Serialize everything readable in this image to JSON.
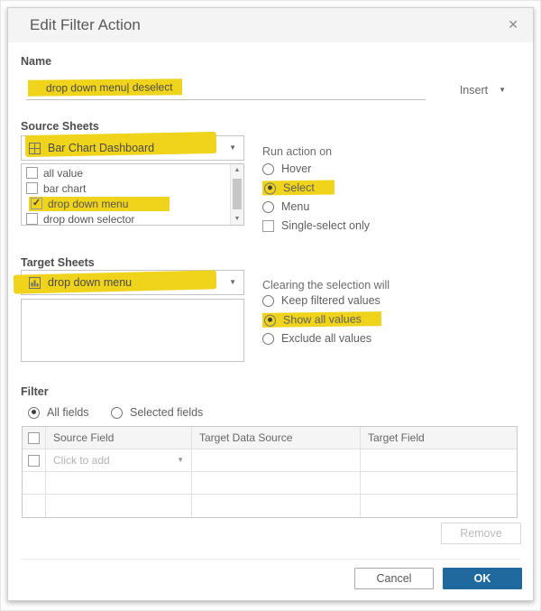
{
  "dialog": {
    "title": "Edit Filter Action"
  },
  "icons": {
    "close": "✕",
    "caret_down": "▼",
    "caret_up": "▲",
    "check": "✓"
  },
  "colors": {
    "highlight_yellow": "#f0d31b",
    "ok_button_blue": "#20699e"
  },
  "name_section": {
    "label": "Name",
    "value": "drop down menu| deselect",
    "insert_label": "Insert"
  },
  "source_sheets": {
    "label": "Source Sheets",
    "selected_value": "Bar Chart Dashboard",
    "selected_icon": "dashboard-icon",
    "items": [
      {
        "label": "all value",
        "checked": false,
        "highlighted": false
      },
      {
        "label": "bar chart",
        "checked": false,
        "highlighted": false
      },
      {
        "label": "drop down menu",
        "checked": true,
        "highlighted": true
      },
      {
        "label": "drop down selector",
        "checked": false,
        "highlighted": false
      }
    ]
  },
  "run_action_on": {
    "label": "Run action on",
    "options": [
      {
        "label": "Hover",
        "selected": false,
        "highlighted": false
      },
      {
        "label": "Select",
        "selected": true,
        "highlighted": true
      },
      {
        "label": "Menu",
        "selected": false,
        "highlighted": false
      }
    ],
    "single_select": {
      "label": "Single-select only",
      "checked": false
    }
  },
  "target_sheets": {
    "label": "Target Sheets",
    "selected_value": "drop down menu",
    "selected_icon": "worksheet-icon"
  },
  "clearing_selection": {
    "label": "Clearing the selection will",
    "options": [
      {
        "label": "Keep filtered values",
        "selected": false,
        "highlighted": false
      },
      {
        "label": "Show all values",
        "selected": true,
        "highlighted": true
      },
      {
        "label": "Exclude all values",
        "selected": false,
        "highlighted": false
      }
    ]
  },
  "filter_section": {
    "label": "Filter",
    "mode_options": [
      {
        "label": "All fields",
        "selected": true
      },
      {
        "label": "Selected fields",
        "selected": false
      }
    ],
    "table": {
      "headers": [
        "Source Field",
        "Target Data Source",
        "Target Field"
      ],
      "placeholder_row": {
        "source_field": "Click to add",
        "target_data_source": "",
        "target_field": ""
      },
      "empty_row_count": 2
    },
    "remove_label": "Remove"
  },
  "footer": {
    "cancel_label": "Cancel",
    "ok_label": "OK"
  }
}
